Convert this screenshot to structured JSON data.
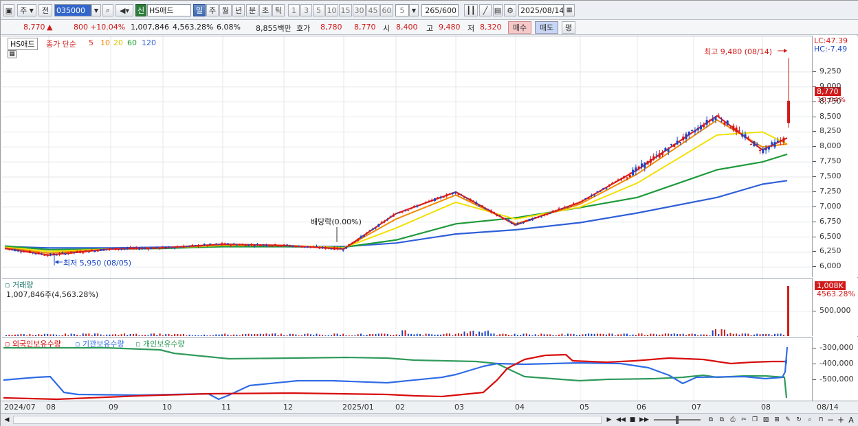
{
  "toolbar": {
    "type_selector": "주",
    "prev_label": "전",
    "code_value": "035000",
    "new_badge": "신",
    "name_value": "HS애드",
    "periods": [
      "일",
      "주",
      "월",
      "년",
      "분",
      "초",
      "틱"
    ],
    "active_period": "일",
    "intervals": [
      "1",
      "3",
      "5",
      "10",
      "15",
      "30",
      "45",
      "60"
    ],
    "custom_interval": "5",
    "count_label": "265/600",
    "date_value": "2025/08/14"
  },
  "quote": {
    "price": "8,770",
    "change": "800",
    "change_rate": "+10.04%",
    "volume": "1,007,846",
    "volume_ratio": "4,563.28%",
    "turnover": "6.08%",
    "amount": "8,855백만",
    "ask_label": "호가",
    "ask1": "8,780",
    "ask2": "8,770",
    "open_label": "시",
    "open": "8,400",
    "high_label": "고",
    "high": "9,480",
    "low_label": "저",
    "low": "8,320",
    "buy_button": "매수",
    "sell_button": "매도",
    "eval_button": "평"
  },
  "price_panel": {
    "legend_name": "HS애드",
    "legend_ma": "종가 단순",
    "ma_periods": [
      "5",
      "10",
      "20",
      "60",
      "120"
    ],
    "lc_label": "LC:47.39",
    "hc_label": "HC:-7.49",
    "high_annotation": "최고 9,480 (08/14)",
    "low_annotation": "최저 5,950 (08/05)",
    "dividend_annotation": "배당락(0.00%)",
    "current_price_tag": "8,770",
    "current_rate_tag": "10.04%",
    "y_ticks": [
      "9,250",
      "9,000",
      "8,750",
      "8,500",
      "8,250",
      "8,000",
      "7,750",
      "7,500",
      "7,250",
      "7,000",
      "6,750",
      "6,500",
      "6,250",
      "6,000"
    ]
  },
  "volume_panel": {
    "title": "거래량",
    "value": "1,007,846주(4,563.28%)",
    "current_tag": "1,008K",
    "current_rate": "4563.28%",
    "y_ticks": [
      "500,000"
    ]
  },
  "holding_panel": {
    "legend": [
      "외국인보유수량",
      "기관보유수량",
      "개인보유수량"
    ],
    "y_ticks": [
      "-300,000",
      "-400,000",
      "-500,000"
    ]
  },
  "date_axis": [
    "2024/07",
    "08",
    "09",
    "10",
    "11",
    "12",
    "2025/01",
    "02",
    "03",
    "04",
    "05",
    "06",
    "07",
    "08",
    "08/14"
  ],
  "colors": {
    "up": "#d11a1a",
    "down": "#1a46c8",
    "ma5": "#e02020",
    "ma10": "#f08a00",
    "ma20": "#f2e000",
    "ma60": "#1f9a3a",
    "ma120": "#2f5fd8",
    "foreign": "#d80c0c",
    "institution": "#2f6be6",
    "individual": "#2f9a5a"
  },
  "chart_data": {
    "type": "line",
    "ylim": [
      5900,
      9500
    ],
    "x": [
      "2024/07",
      "08",
      "09",
      "10",
      "11",
      "12",
      "2025/01",
      "02",
      "03",
      "04",
      "05",
      "06",
      "07",
      "08",
      "08/14"
    ],
    "series": [
      {
        "name": "5",
        "values": [
          6310,
          6200,
          6300,
          6320,
          6380,
          6360,
          6300,
          6890,
          7250,
          6700,
          7080,
          7620,
          8520,
          7950,
          8150
        ]
      },
      {
        "name": "10",
        "values": [
          6320,
          6230,
          6300,
          6320,
          6370,
          6360,
          6310,
          6800,
          7200,
          6720,
          7050,
          7550,
          8450,
          8000,
          8050
        ]
      },
      {
        "name": "20",
        "values": [
          6330,
          6260,
          6300,
          6320,
          6360,
          6360,
          6320,
          6650,
          7080,
          6800,
          7000,
          7400,
          8200,
          8250,
          8050
        ]
      },
      {
        "name": "60",
        "values": [
          6350,
          6290,
          6300,
          6310,
          6340,
          6340,
          6330,
          6450,
          6720,
          6820,
          6990,
          7160,
          7620,
          7750,
          7880
        ]
      },
      {
        "name": "120",
        "values": [
          6340,
          6320,
          6320,
          6330,
          6340,
          6340,
          6340,
          6400,
          6550,
          6620,
          6740,
          6900,
          7160,
          7380,
          7440
        ]
      }
    ]
  }
}
